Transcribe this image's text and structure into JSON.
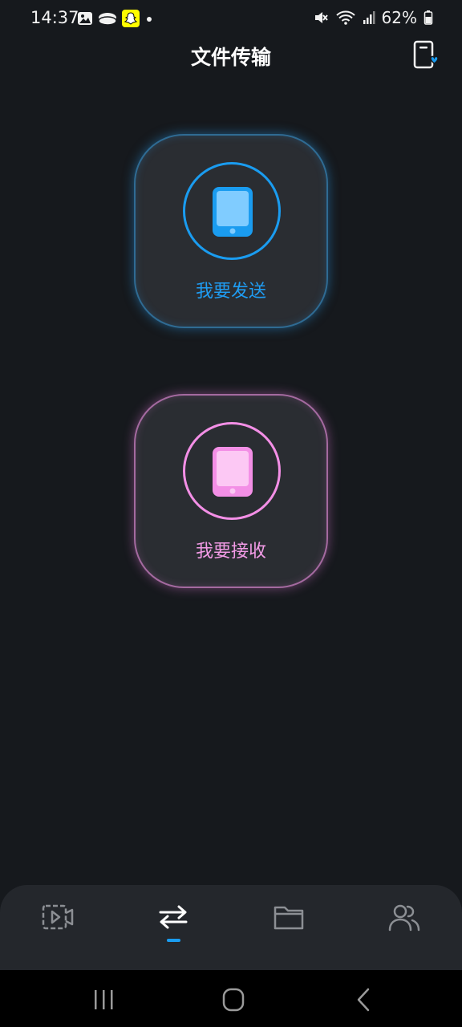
{
  "status_bar": {
    "time": "14:37",
    "battery": "62%",
    "left_icons": [
      "gallery-icon",
      "cloud-icon",
      "snapchat-icon",
      "dot-icon"
    ],
    "right_icons": [
      "mute-icon",
      "wifi-icon",
      "signal-icon",
      "battery-icon"
    ]
  },
  "header": {
    "title": "文件传输",
    "history_icon": "transfer-history-icon"
  },
  "cards": {
    "send": {
      "label": "我要发送",
      "color": "#1a9cf0",
      "icon": "phone-icon"
    },
    "receive": {
      "label": "我要接收",
      "color": "#f38fe6",
      "icon": "phone-icon"
    }
  },
  "tab_bar": {
    "tabs": [
      {
        "icon": "video-icon",
        "active": false
      },
      {
        "icon": "transfer-arrows-icon",
        "active": true
      },
      {
        "icon": "folder-icon",
        "active": false
      },
      {
        "icon": "users-icon",
        "active": false
      }
    ],
    "accent": "#1a9cf0"
  },
  "nav_bar": {
    "buttons": [
      "recents-icon",
      "home-icon",
      "back-icon"
    ]
  },
  "colors": {
    "background": "#16191d",
    "card": "#2a2d32",
    "tab_bar": "#24272c"
  }
}
